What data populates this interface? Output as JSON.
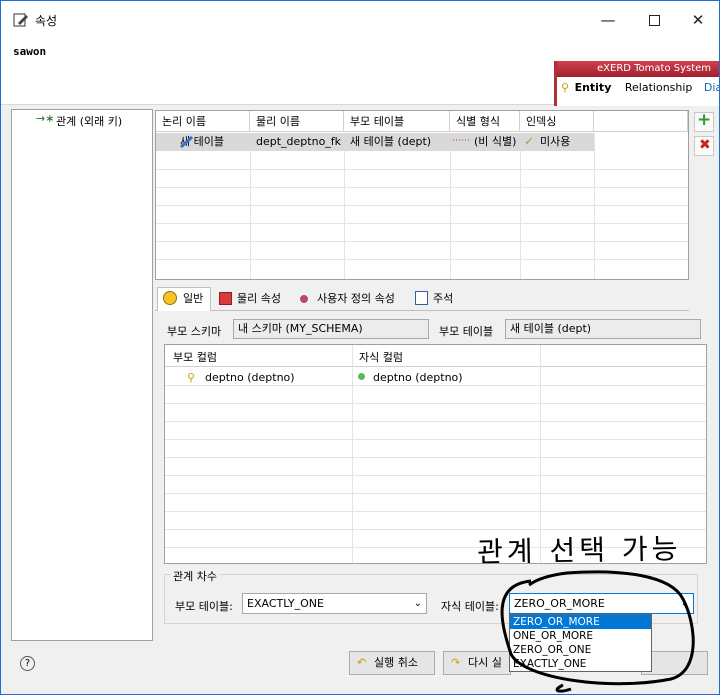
{
  "window": {
    "title": "속성",
    "entity_name": "sawon"
  },
  "exerd": {
    "brand": "eXERD  Tomato System",
    "tab_entity": "Entity",
    "tab_relationship": "Relationship",
    "tab_diagram": "Diag"
  },
  "side_list": {
    "items": [
      {
        "label": "관계 (외래 키)"
      }
    ]
  },
  "rel_table": {
    "columns": [
      "논리 이름",
      "물리 이름",
      "부모 테이블",
      "식별 형식",
      "인덱싱"
    ],
    "rows": [
      {
        "logical": "새 테이블",
        "physical": "dept_deptno_fk",
        "parent": "새 테이블 (dept)",
        "ident": "(비 식별)",
        "indexing": "미사용"
      }
    ]
  },
  "tabs": [
    {
      "label": "일반"
    },
    {
      "label": "물리 속성"
    },
    {
      "label": "사용자 정의 속성"
    },
    {
      "label": "주석"
    }
  ],
  "general": {
    "parent_schema_label": "부모 스키마",
    "parent_schema_value": "내 스키마 (MY_SCHEMA)",
    "parent_table_label": "부모 테이블",
    "parent_table_value": "새 테이블 (dept)",
    "columns_header": [
      "부모 컬럼",
      "자식 컬럼"
    ],
    "columns_rows": [
      {
        "parent": "deptno (deptno)",
        "child": "deptno (deptno)"
      }
    ]
  },
  "cardinality": {
    "group_label": "관계 차수",
    "parent_label": "부모 테이블:",
    "parent_value": "EXACTLY_ONE",
    "child_label": "자식 테이블:",
    "child_value": "ZERO_OR_MORE",
    "options": [
      "ZERO_OR_MORE",
      "ONE_OR_MORE",
      "ZERO_OR_ONE",
      "EXACTLY_ONE"
    ],
    "selected_option": "ZERO_OR_MORE"
  },
  "footer": {
    "cancel_label": "실행 취소",
    "redo_label": "다시 실",
    "help": "?"
  },
  "annotation": {
    "text": "관계 선택 가능"
  },
  "colors": {
    "accent": "#0078d7",
    "selection": "#d9d9d9",
    "brand_red": "#b0303a",
    "ink": "#000000"
  }
}
